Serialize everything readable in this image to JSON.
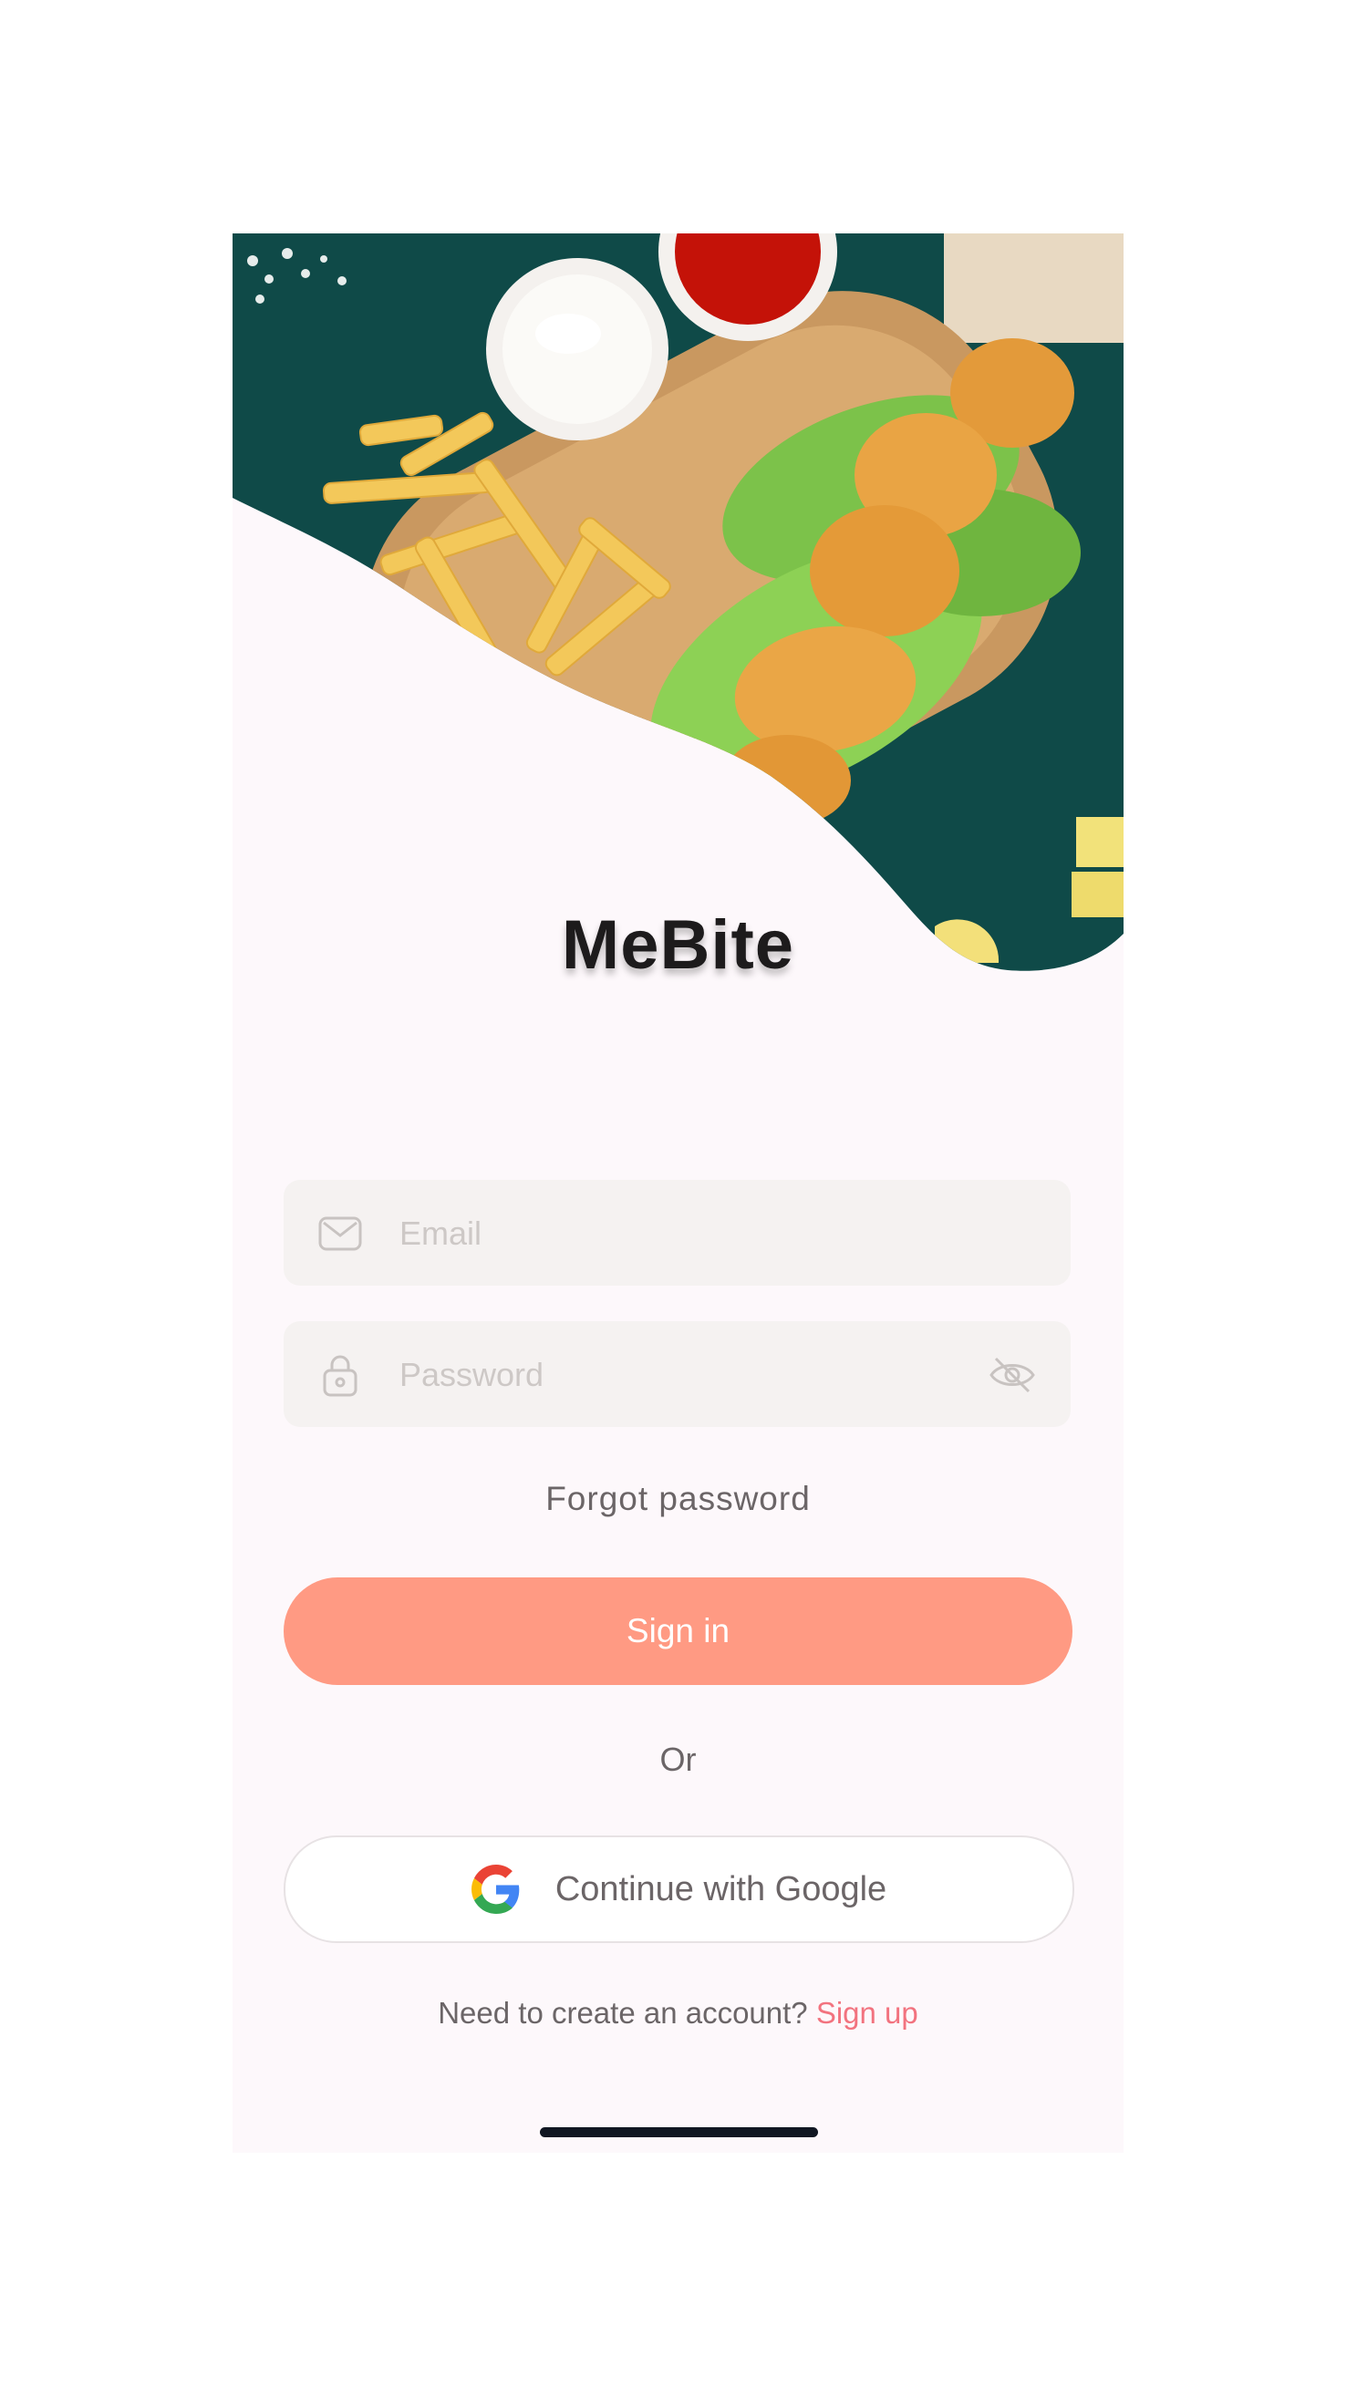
{
  "app": {
    "name": "MeBite"
  },
  "login": {
    "email_placeholder": "Email",
    "password_placeholder": "Password",
    "forgot_label": "Forgot password",
    "signin_label": "Sign in",
    "or_label": "Or",
    "google_label": "Continue with Google",
    "signup_prompt": "Need to create an account?",
    "signup_link": "Sign up"
  },
  "icons": {
    "email": "envelope-icon",
    "password": "lock-icon",
    "toggle": "eye-off-icon",
    "google": "google-icon"
  },
  "colors": {
    "accent": "#ff9a83",
    "link": "#f2737f",
    "background": "#fdf8fb",
    "field": "#f5f2f1",
    "text": "#6b6567"
  }
}
